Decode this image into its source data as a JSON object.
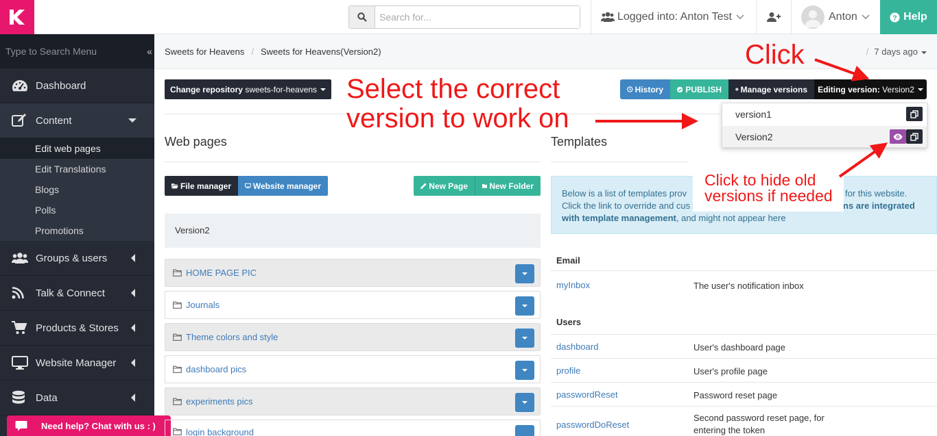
{
  "header": {
    "search_placeholder": "Search for...",
    "logged_in": "Logged into: Anton Test",
    "user_name": "Anton",
    "help": "Help"
  },
  "sidebar": {
    "search_placeholder": "Type to Search Menu",
    "items": [
      {
        "label": "Dashboard",
        "icon": "dashboard-icon"
      },
      {
        "label": "Content",
        "icon": "edit-icon"
      },
      {
        "label": "Groups & users",
        "icon": "users-icon"
      },
      {
        "label": "Talk & Connect",
        "icon": "rss-icon"
      },
      {
        "label": "Products & Stores",
        "icon": "cart-icon"
      },
      {
        "label": "Website Manager",
        "icon": "monitor-icon"
      },
      {
        "label": "Data",
        "icon": "database-icon"
      }
    ],
    "content_sub": [
      "Edit web pages",
      "Edit Translations",
      "Blogs",
      "Polls",
      "Promotions"
    ],
    "chat": "Need help? Chat with us : )"
  },
  "breadcrumb": {
    "items": [
      "Sweets for Heavens",
      "Sweets for Heavens(Version2)"
    ],
    "ago": "7 days ago"
  },
  "toolbar": {
    "repo_label": "Change repository",
    "repo_value": "sweets-for-heavens",
    "history": "History",
    "publish": "PUBLISH",
    "manage": "Manage versions",
    "editing_label": "Editing version:",
    "editing_value": "Version2"
  },
  "versions": [
    "version1",
    "Version2"
  ],
  "webpages": {
    "title": "Web pages",
    "file_manager": "File manager",
    "website_manager": "Website manager",
    "new_page": "New Page",
    "new_folder": "New Folder",
    "current_version": "Version2",
    "folders": [
      "HOME PAGE PIC",
      "Journals",
      "Theme colors and style",
      "dashboard pics",
      "experiments pics",
      "login background"
    ]
  },
  "templates": {
    "title": "Templates",
    "info_1": "Below is a list of templates prov",
    "info_2": "for this website.",
    "info_3": "Click the link to override and cus",
    "info_4": "ns are integrated",
    "info_5": "with template management",
    "info_6": ", and might not appear here",
    "sections": [
      {
        "name": "Email",
        "rows": [
          {
            "name": "myInbox",
            "desc": "The user's notification inbox"
          }
        ]
      },
      {
        "name": "Users",
        "rows": [
          {
            "name": "dashboard",
            "desc": "User's dashboard page"
          },
          {
            "name": "profile",
            "desc": "User's profile page"
          },
          {
            "name": "passwordReset",
            "desc": "Password reset page"
          },
          {
            "name": "passwordDoReset",
            "desc": "Second password reset page, for entering the token"
          }
        ]
      }
    ]
  },
  "annotations": {
    "click": "Click",
    "select_1": "Select the correct",
    "select_2": "version to work on",
    "hide_1": "Click to hide old",
    "hide_2": "versions if needed"
  },
  "colors": {
    "brand": "#e6176c",
    "teal": "#36b59a",
    "blue": "#3f86c3",
    "dark": "#252a35",
    "annotation": "#f01818"
  }
}
